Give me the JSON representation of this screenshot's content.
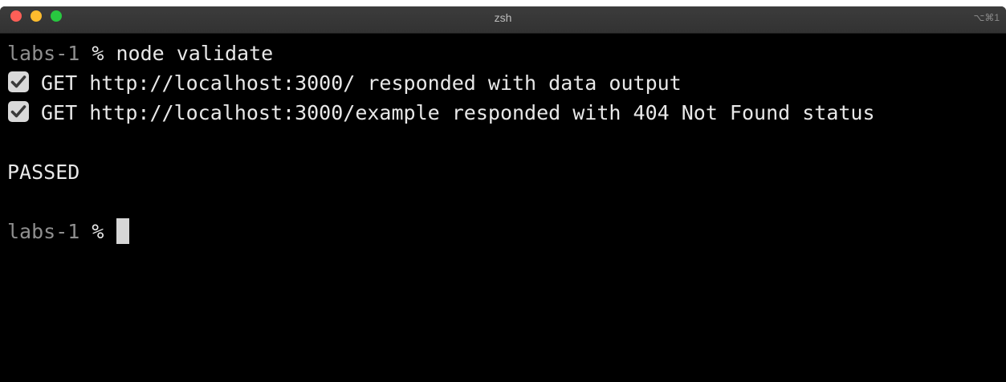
{
  "window": {
    "title": "zsh",
    "shortcut": "⌥⌘1"
  },
  "terminal": {
    "lines": [
      {
        "prompt": "labs-1",
        "symbol": "%",
        "command": "node validate"
      },
      {
        "icon": "check-icon",
        "text": "GET http://localhost:3000/ responded with data output"
      },
      {
        "icon": "check-icon",
        "text": "GET http://localhost:3000/example responded with 404 Not Found status"
      },
      {
        "text": ""
      },
      {
        "text": "PASSED"
      },
      {
        "text": ""
      },
      {
        "prompt": "labs-1",
        "symbol": "%",
        "command": ""
      }
    ]
  },
  "colors": {
    "background": "#000000",
    "text": "#e8e8e8",
    "prompt_host": "#8f8f8f",
    "check_box": "#d9d9d9",
    "cursor": "#d6d6d6"
  }
}
